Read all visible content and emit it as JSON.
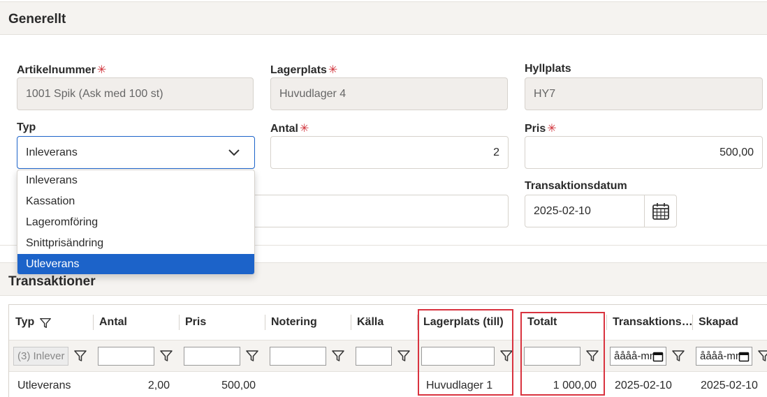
{
  "general": {
    "title": "Generellt",
    "artikelnummer": {
      "label": "Artikelnummer",
      "value": "1001 Spik (Ask med 100 st)"
    },
    "lagerplats": {
      "label": "Lagerplats",
      "value": "Huvudlager 4"
    },
    "hyllplats": {
      "label": "Hyllplats",
      "value": "HY7"
    },
    "typ": {
      "label": "Typ",
      "value": "Inleverans"
    },
    "antal": {
      "label": "Antal",
      "value": "2"
    },
    "pris": {
      "label": "Pris",
      "value": "500,00"
    },
    "transaktionsdatum": {
      "label": "Transaktionsdatum",
      "value": "2025-02-10"
    },
    "required_mark": "✳"
  },
  "dropdown": {
    "options": [
      "Inleverans",
      "Kassation",
      "Lageromföring",
      "Snittprisändring",
      "Utleverans"
    ],
    "highlighted": "Utleverans"
  },
  "transactions": {
    "title": "Transaktioner",
    "columns": [
      "Typ",
      "Antal",
      "Pris",
      "Notering",
      "Källa",
      "Lagerplats (till)",
      "Totalt",
      "Transaktions…",
      "Skapad"
    ],
    "filters": {
      "typ": "(3) Inlever",
      "date_placeholder": "åååå-mm-dd"
    },
    "rows": [
      {
        "typ": "Utleverans",
        "antal": "2,00",
        "pris": "500,00",
        "notering": "",
        "kalla": "",
        "lagerplats_till": "Huvudlager 1",
        "totalt": "1 000,00",
        "transaktionsdatum": "2025-02-10",
        "skapad": "2025-02-10"
      }
    ]
  },
  "colors": {
    "accent": "#1c63c9",
    "highlight_box": "#d9333f",
    "required": "#d0323a"
  }
}
